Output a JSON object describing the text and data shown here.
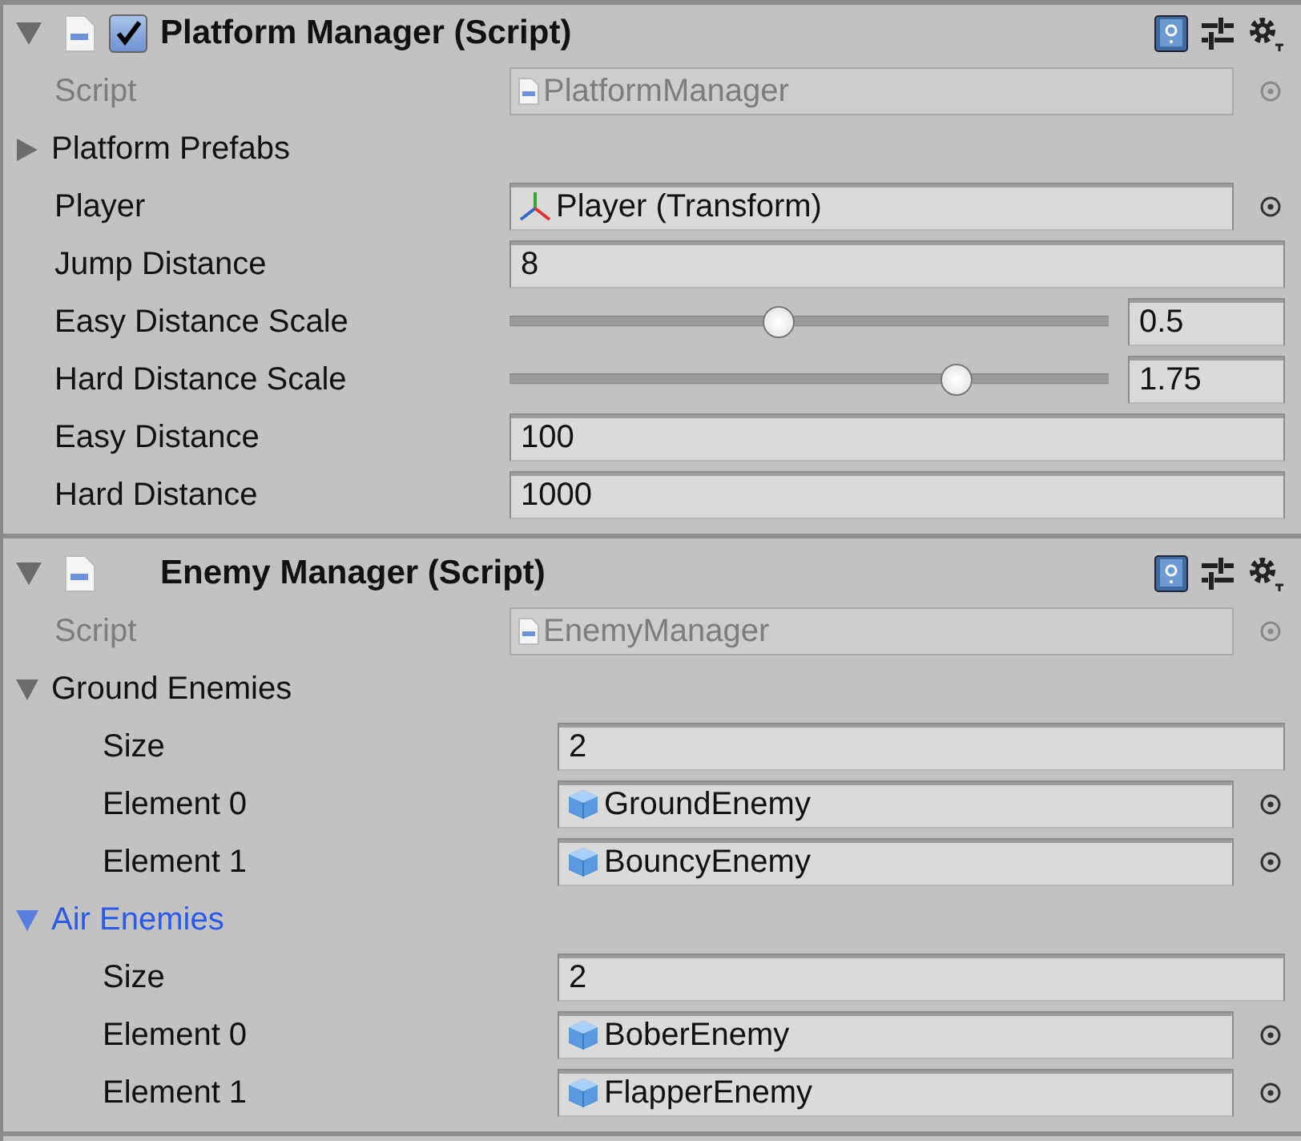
{
  "components": [
    {
      "title": "Platform Manager (Script)",
      "kind": "toggle",
      "checked": true,
      "expanded": true,
      "rows": [
        {
          "kind": "script",
          "label": "Script",
          "value": "PlatformManager",
          "disabled": true
        },
        {
          "kind": "foldout",
          "label": "Platform Prefabs",
          "expanded": false,
          "selected": false
        },
        {
          "kind": "transform-ref",
          "label": "Player",
          "value": "Player (Transform)"
        },
        {
          "kind": "number",
          "label": "Jump Distance",
          "value": "8"
        },
        {
          "kind": "slider",
          "label": "Easy Distance Scale",
          "value": "0.5",
          "level": 0.45
        },
        {
          "kind": "slider",
          "label": "Hard Distance Scale",
          "value": "1.75",
          "level": 0.745
        },
        {
          "kind": "number",
          "label": "Easy Distance",
          "value": "100"
        },
        {
          "kind": "number",
          "label": "Hard Distance",
          "value": "1000"
        }
      ]
    },
    {
      "title": "Enemy Manager (Script)",
      "kind": "fixed",
      "expanded": true,
      "rows": [
        {
          "kind": "script",
          "label": "Script",
          "value": "EnemyManager",
          "disabled": true
        },
        {
          "kind": "foldout",
          "label": "Ground Enemies",
          "expanded": true,
          "selected": false,
          "children": [
            {
              "kind": "number",
              "label": "Size",
              "value": "2"
            },
            {
              "kind": "prefab-ref",
              "label": "Element 0",
              "value": "GroundEnemy"
            },
            {
              "kind": "prefab-ref",
              "label": "Element 1",
              "value": "BouncyEnemy"
            }
          ]
        },
        {
          "kind": "foldout",
          "label": "Air Enemies",
          "expanded": true,
          "selected": true,
          "children": [
            {
              "kind": "number",
              "label": "Size",
              "value": "2"
            },
            {
              "kind": "prefab-ref",
              "label": "Element 0",
              "value": "BoberEnemy"
            },
            {
              "kind": "prefab-ref",
              "label": "Element 1",
              "value": "FlapperEnemy"
            }
          ]
        }
      ]
    }
  ]
}
